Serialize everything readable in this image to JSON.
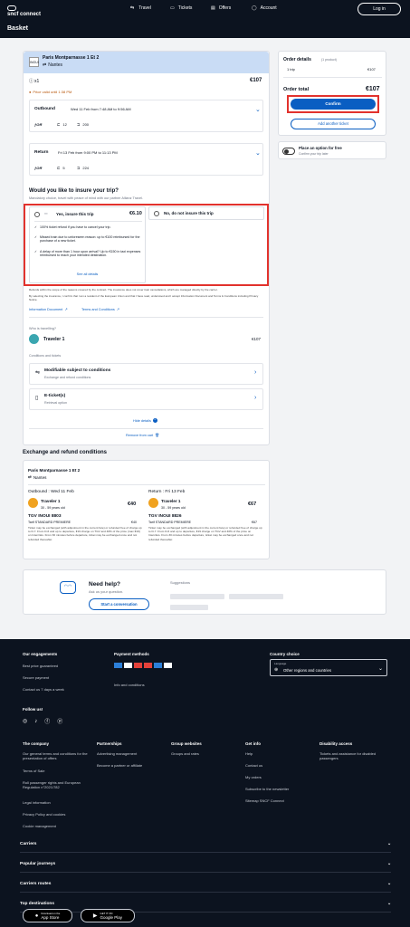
{
  "brand": "sncf connect",
  "nav": {
    "travel": "Travel",
    "tickets": "Tickets",
    "offers": "Offers",
    "account": "Account",
    "login": "Log in"
  },
  "page_title": "Basket",
  "trip": {
    "origin": "Paris Montparnasse 1 Et 2",
    "destination": "Nantes",
    "passengers": "x1",
    "price": "€107",
    "hold_notice": "Price valid until 1:38 PM",
    "outbound": {
      "label": "Outbound",
      "schedule": "Wed 11 Feb from 7:48 AM to 9:56 AM",
      "coach": "12",
      "seat": "200"
    },
    "return": {
      "label": "Return",
      "schedule": "Fri 13 Feb from 9:00 PM to 11:13 PM",
      "coach": "5",
      "seat": "224"
    }
  },
  "insurance": {
    "title": "Would you like to insure your trip?",
    "subtitle": "Mandatory choice, travel with peace of mind with our partner Allianz Travel.",
    "yes_label": "Yes, insure this trip",
    "yes_price": "€6.10",
    "no_label": "No, do not insure this trip",
    "benefits": [
      "100% ticket refund if you have to cancel your trip.",
      "Missed train due to unforeseen reason: up to €100 reimbursed for the purchase of a new ticket.",
      "A delay of more than 1 hour upon arrival? Up to €150 in taxi expenses reimbursed to reach your intended destination."
    ],
    "see_all": "See all details",
    "legal1": "Refunds within the scope of the reasons covered by the contract. The insurance does not cover train cancellations, which are managed directly by the carrier.",
    "legal2": "By selecting the insurance, I confirm that I am a resident of the European Union and that I have read, understood and I accept Information Document and Terms & Conditions including Privacy Notice.",
    "info_doc": "Information Document",
    "terms": "Terms and Conditions"
  },
  "traveller": {
    "question": "Who is travelling?",
    "name": "Traveler 1",
    "price": "€107",
    "conditions_title": "Conditions and tickets",
    "modifiable": "Modifiable subject to conditions",
    "modifiable_sub": "Exchange and refund conditions",
    "eticket": "E-ticket(s)",
    "eticket_sub": "Retrieval option",
    "hide": "Hide details",
    "remove": "Remove from cart"
  },
  "exchange": {
    "title": "Exchange and refund conditions",
    "origin": "Paris Montparnasse 1 Et 2",
    "destination": "Nantes",
    "out": {
      "header": "Outbound : Wed 11 Feb",
      "traveler": "Traveler 1",
      "age": "30 - 59 years old",
      "price": "€40",
      "train": "TGV INOUI 8803",
      "tariff": "Tarif STANDARD PREMIERE",
      "tariff_price": "€40",
      "text": "Ticket may be exchanged (with adjustment in the current fare) or refunded free of charge up to D-7. From D-6 and up to departure, €19 charge on TGV and 40% of the price (max €19) on Intercités. From 30 minutes before departure, ticket may be exchanged once and not refunded thereafter."
    },
    "ret": {
      "header": "Return : Fri 13 Feb",
      "traveler": "Traveler 1",
      "age": "30 - 59 years old",
      "price": "€67",
      "train": "TGV INOUI 8826",
      "tariff": "Tarif STANDARD PREMIERE",
      "tariff_price": "€67",
      "text": "Ticket may be exchanged (with adjustment in the current fare) or refunded free of charge up to D-7. From D-6 and up to departure, €19 charge on TGV and 40% of the price on Intercités. From 30 minutes before departure, ticket may be exchanged once and not refunded thereafter."
    }
  },
  "order": {
    "title": "Order details",
    "count": "(1 product)",
    "item": "1 trip",
    "item_price": "€107",
    "total_label": "Order total",
    "total": "€107",
    "confirm": "Confirm",
    "add_another": "Add another ticket",
    "option_title": "Place an option for free",
    "option_sub": "Confirm your trip later"
  },
  "help": {
    "title": "Need help?",
    "sub": "Ask us your question.",
    "button": "Start a conversation",
    "suggestions": "Suggestions"
  },
  "footer": {
    "engagements": {
      "title": "Our engagements",
      "items": [
        "Best price guaranteed",
        "Secure payment",
        "Contact us 7 days a week"
      ]
    },
    "payment": {
      "title": "Payment methods",
      "info": "Info and conditions"
    },
    "country": {
      "title": "Country choice",
      "label": "Language",
      "value": "Other regions and countries"
    },
    "follow": "Follow us!",
    "company": {
      "title": "The company",
      "items": [
        "Our general terms and conditions for the presentation of offers",
        "Terms of Sale",
        "Roll passenger rights and European Regulation n°2021/782",
        "Legal information",
        "Privacy Policy and cookies",
        "Cookie management"
      ]
    },
    "partnerships": {
      "title": "Partnerships",
      "items": [
        "Advertising management",
        "Become a partner or affiliate"
      ]
    },
    "group": {
      "title": "Group websites",
      "items": [
        "Groups and rates"
      ]
    },
    "getinfo": {
      "title": "Get info",
      "items": [
        "Help",
        "Contact us",
        "My orders",
        "Subscribe to the newsletter",
        "Sitemap SNCF Connect"
      ]
    },
    "disability": {
      "title": "Disability access",
      "items": [
        "Tickets and assistance for disabled passengers"
      ]
    },
    "accordions": [
      "Carriers",
      "Popular journeys",
      "Carriers routes",
      "Top destinations"
    ],
    "appstore": "App Store",
    "googleplay": "Google Play",
    "appstore_pre": "Download on the",
    "googleplay_pre": "GET IT ON"
  }
}
